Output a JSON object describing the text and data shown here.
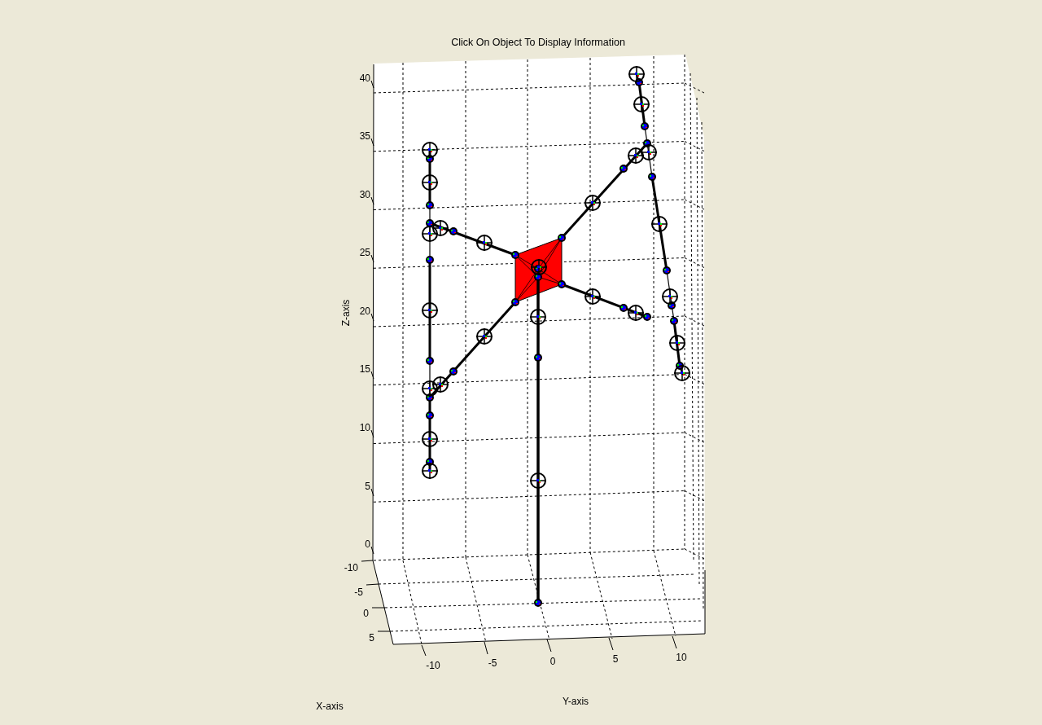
{
  "figure_title": "Click On Object To Display Information",
  "axes": {
    "z_label": "Z-axis",
    "x_label": "X-axis",
    "y_label": "Y-axis",
    "z_ticks": [
      "40",
      "35",
      "30",
      "25",
      "20",
      "15",
      "10",
      "5",
      "0"
    ],
    "x_ticks": [
      "-10",
      "-5",
      "0",
      "5"
    ],
    "y_ticks": [
      "-10",
      "-5",
      "0",
      "5",
      "10"
    ]
  }
}
